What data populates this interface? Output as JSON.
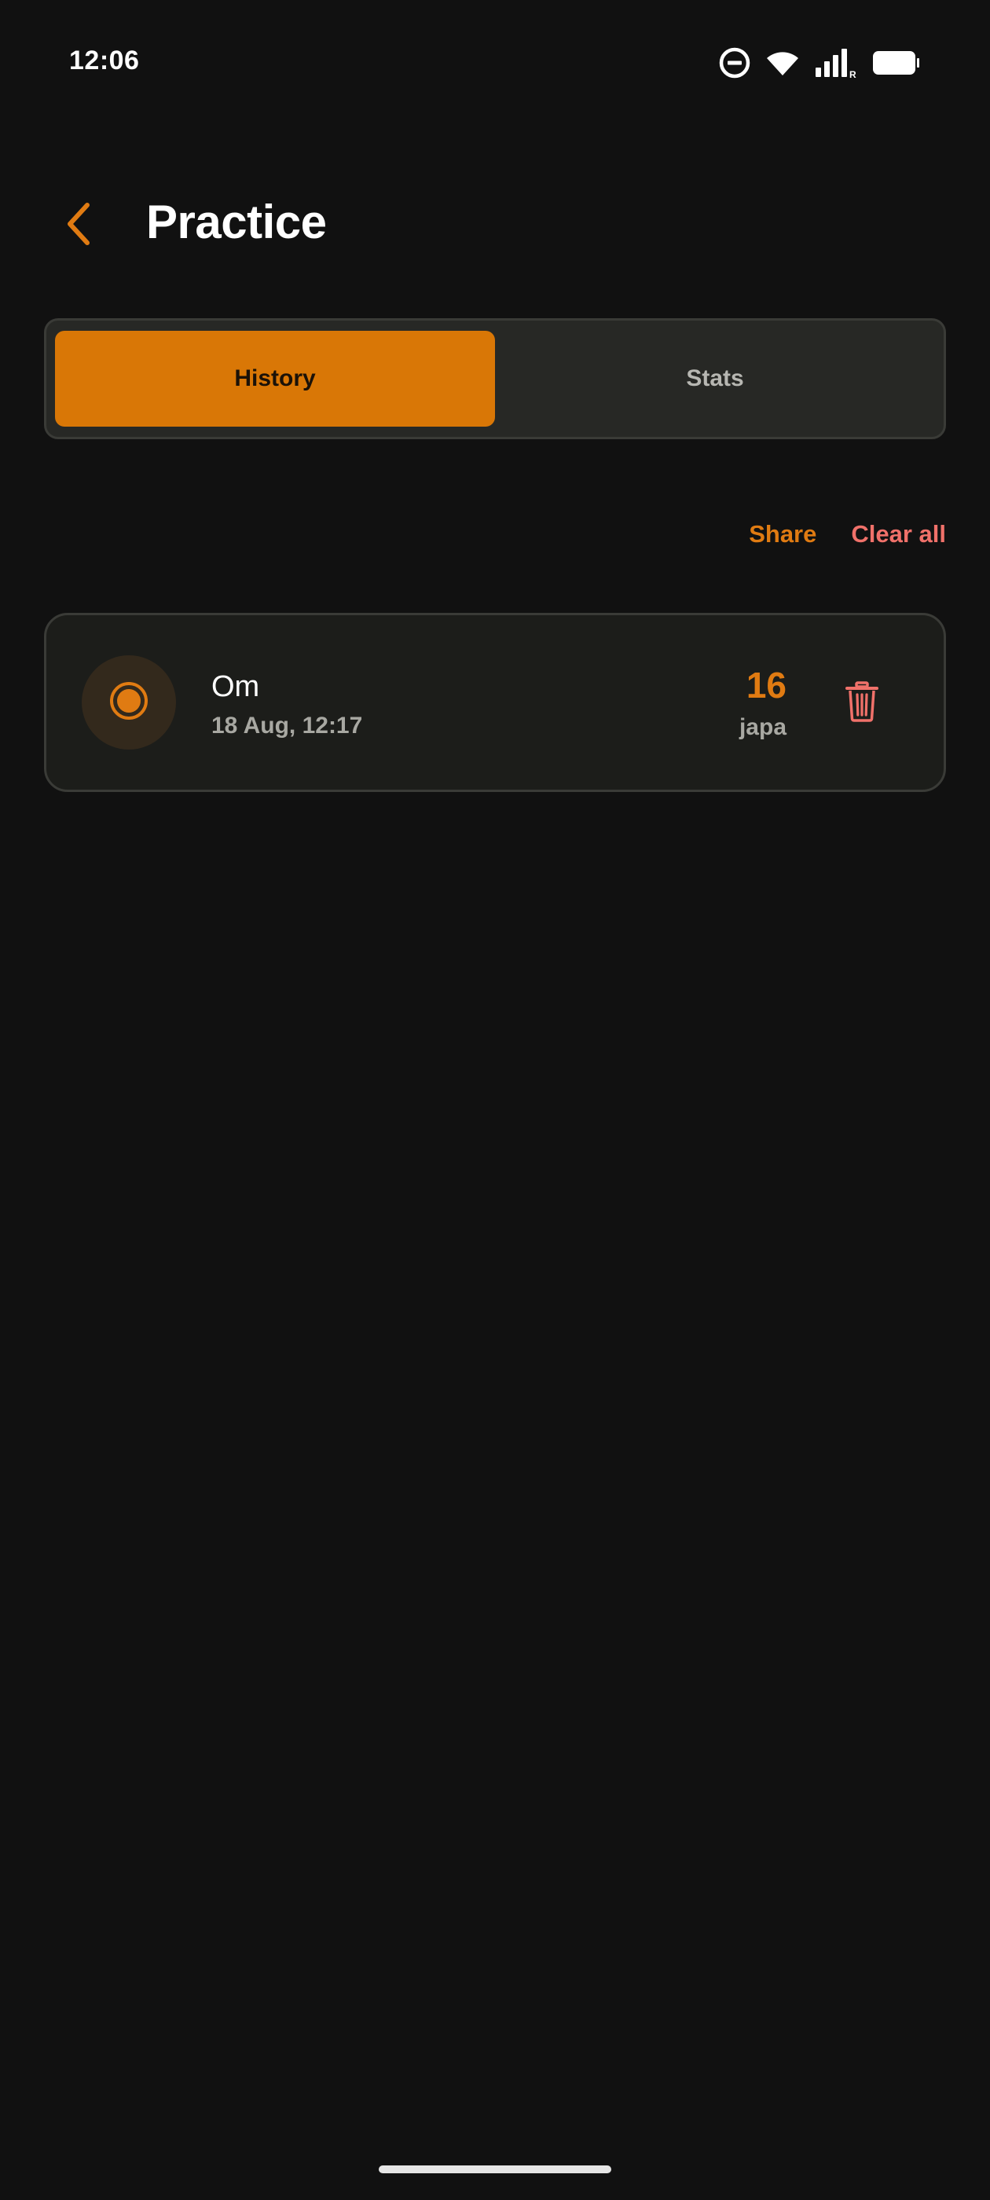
{
  "status_bar": {
    "time": "12:06",
    "icons": [
      "do-not-disturb-icon",
      "wifi-icon",
      "cellular-signal-icon",
      "battery-icon"
    ]
  },
  "header": {
    "title": "Practice",
    "back_icon": "chevron-left-icon"
  },
  "tabs": [
    {
      "label": "History",
      "active": true
    },
    {
      "label": "Stats",
      "active": false
    }
  ],
  "actions": {
    "share_label": "Share",
    "clear_label": "Clear all"
  },
  "sessions": [
    {
      "name": "Om",
      "datetime": "18 Aug, 12:17",
      "count": "16",
      "unit": "japa",
      "icon": "target-icon",
      "delete_icon": "trash-icon"
    }
  ],
  "colors": {
    "background": "#111111",
    "accent": "#d97706",
    "accent_text": "#e07b12",
    "danger": "#f0716a",
    "card": "#1c1d1a",
    "muted_text": "#a8a8a2"
  }
}
